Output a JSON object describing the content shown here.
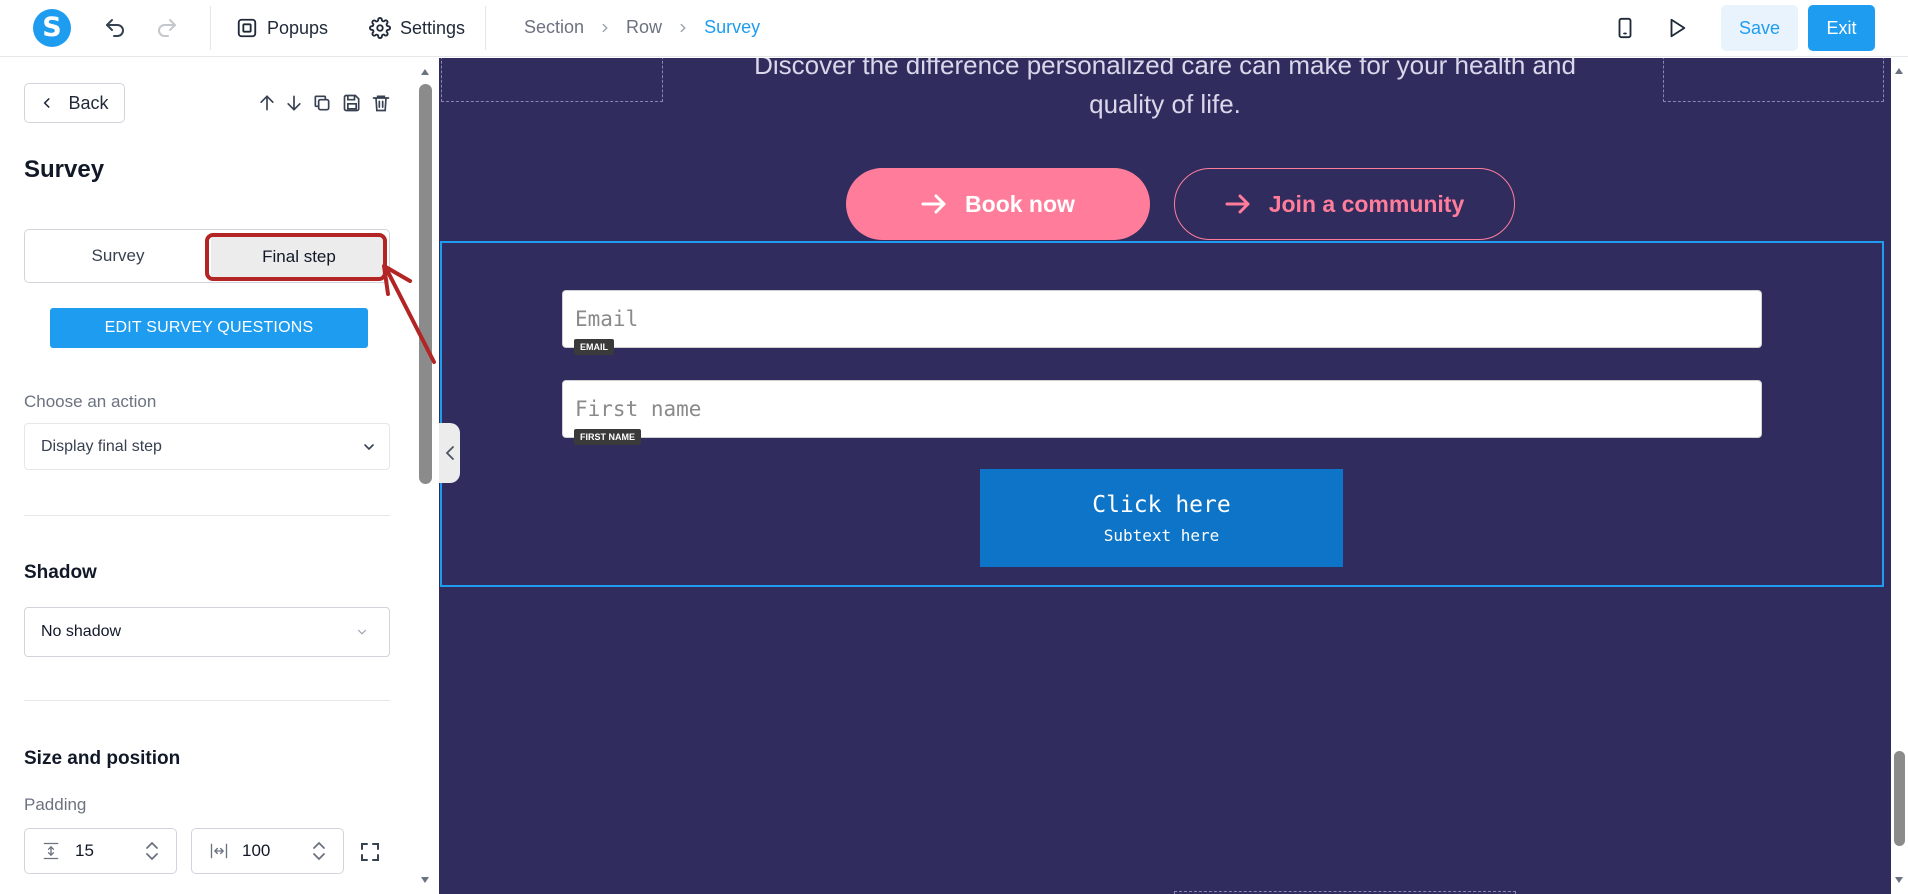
{
  "topbar": {
    "logo_letter": "S",
    "menu": {
      "popups": "Popups",
      "settings": "Settings"
    },
    "breadcrumb": [
      "Section",
      "Row",
      "Survey"
    ],
    "save_label": "Save",
    "exit_label": "Exit"
  },
  "panel": {
    "back_label": "Back",
    "title": "Survey",
    "tabs": {
      "survey": "Survey",
      "final": "Final step"
    },
    "edit_button": "EDIT SURVEY QUESTIONS",
    "action_label": "Choose an action",
    "action_value": "Display final step",
    "shadow_title": "Shadow",
    "shadow_value": "No shadow",
    "size_title": "Size and position",
    "padding_label": "Padding",
    "padding_vertical": "15",
    "padding_horizontal": "100"
  },
  "canvas": {
    "hero_line1": "Discover the difference personalized care can make for your health and",
    "hero_line2": "quality of life.",
    "book_label": "Book now",
    "join_label": "Join a community",
    "email_placeholder": "Email",
    "email_tag": "EMAIL",
    "firstname_placeholder": "First name",
    "firstname_tag": "FIRST NAME",
    "submit_main": "Click here",
    "submit_sub": "Subtext here"
  },
  "colors": {
    "accent": "#1e9cf0",
    "canvas_bg": "#302c5e",
    "cta_pink": "#ff7d9a",
    "submit_blue": "#0d74c8",
    "annotation_red": "#b32424"
  }
}
